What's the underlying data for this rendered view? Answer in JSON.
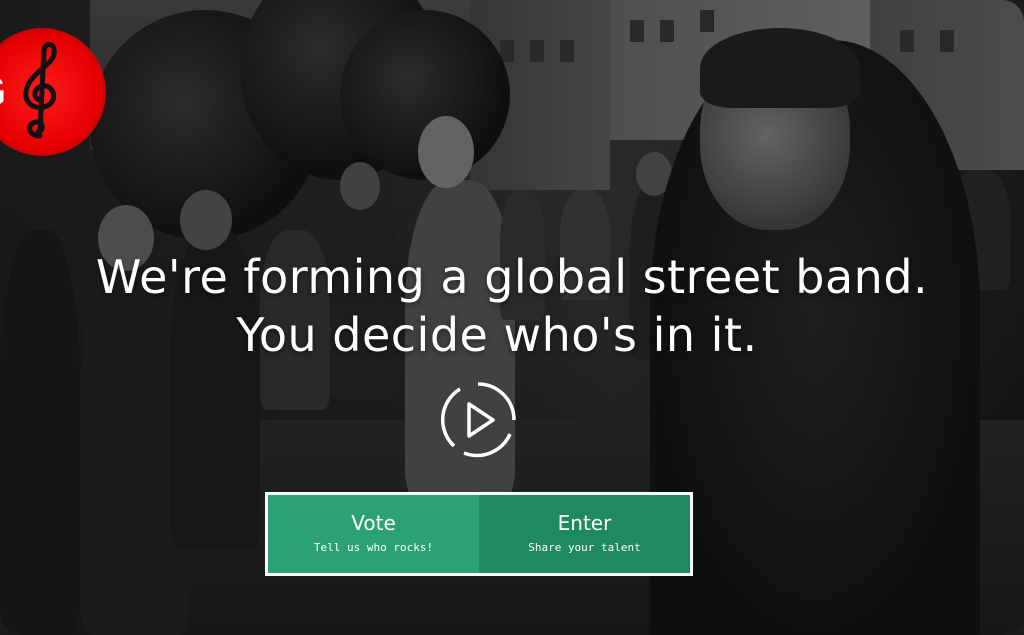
{
  "logo": {
    "letter": "G",
    "icon": "treble-clef-icon",
    "color": "#e40000"
  },
  "hero": {
    "line1": "We're forming a global street band.",
    "line2": "You decide who's in it."
  },
  "play_button": {
    "icon": "play-icon"
  },
  "cta": {
    "vote": {
      "title": "Vote",
      "subtitle": "Tell us who rocks!",
      "color": "#2aa274"
    },
    "enter": {
      "title": "Enter",
      "subtitle": "Share your talent",
      "color": "#1f8a60"
    }
  }
}
